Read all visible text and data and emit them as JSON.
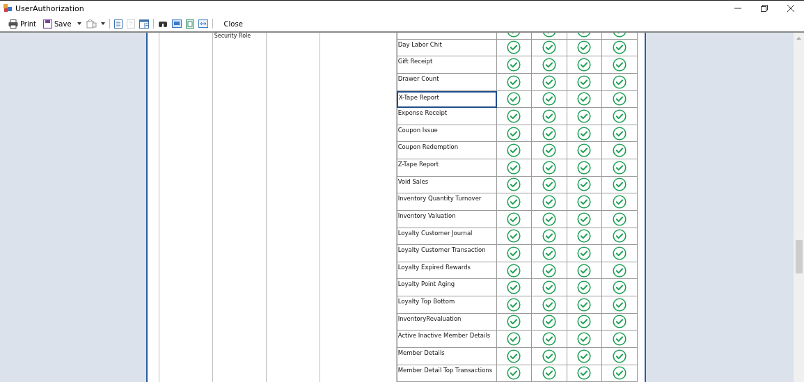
{
  "window": {
    "title": "UserAuthorization"
  },
  "toolbar": {
    "print": "Print",
    "save": "Save",
    "close": "Close"
  },
  "report": {
    "column_3_heading": "Security Role",
    "rows": [
      {
        "checks": [
          true,
          true,
          true,
          true
        ],
        "selected": false
      },
      {
        "label": "Day Labor Chit",
        "checks": [
          true,
          true,
          true,
          true
        ],
        "selected": false
      },
      {
        "label": "Gift Receipt",
        "checks": [
          true,
          true,
          true,
          true
        ],
        "selected": false
      },
      {
        "label": "Drawer Count",
        "checks": [
          true,
          true,
          true,
          true
        ],
        "selected": false
      },
      {
        "label": "X-Tape Report",
        "checks": [
          true,
          true,
          true,
          true
        ],
        "selected": true
      },
      {
        "label": "Expense Receipt",
        "checks": [
          true,
          true,
          true,
          true
        ],
        "selected": false
      },
      {
        "label": "Coupon Issue",
        "checks": [
          true,
          true,
          true,
          true
        ],
        "selected": false
      },
      {
        "label": "Coupon Redemption",
        "checks": [
          true,
          true,
          true,
          true
        ],
        "selected": false
      },
      {
        "label": "Z-Tape Report",
        "checks": [
          true,
          true,
          true,
          true
        ],
        "selected": false
      },
      {
        "label": "Void Sales",
        "checks": [
          true,
          true,
          true,
          true
        ],
        "selected": false
      },
      {
        "label": "Inventory Quantity Turnover",
        "checks": [
          true,
          true,
          true,
          true
        ],
        "selected": false
      },
      {
        "label": "Inventory Valuation",
        "checks": [
          true,
          true,
          true,
          true
        ],
        "selected": false
      },
      {
        "label": "Loyalty Customer Journal",
        "checks": [
          true,
          true,
          true,
          true
        ],
        "selected": false
      },
      {
        "label": "Loyalty Customer Transaction",
        "checks": [
          true,
          true,
          true,
          true
        ],
        "selected": false
      },
      {
        "label": "Loyalty Expired Rewards",
        "checks": [
          true,
          true,
          true,
          true
        ],
        "selected": false
      },
      {
        "label": "Loyalty Point Aging",
        "checks": [
          true,
          true,
          true,
          true
        ],
        "selected": false
      },
      {
        "label": "Loyalty Top Bottom",
        "checks": [
          true,
          true,
          true,
          true
        ],
        "selected": false
      },
      {
        "label": "InventoryRevaluation",
        "checks": [
          true,
          true,
          true,
          true
        ],
        "selected": false
      },
      {
        "label": "Active Inactive Member Details",
        "checks": [
          true,
          true,
          true,
          true
        ],
        "selected": false
      },
      {
        "label": "Member Details",
        "checks": [
          true,
          true,
          true,
          true
        ],
        "selected": false
      },
      {
        "label": "Member Detail Top Transactions",
        "checks": [
          true,
          true,
          true,
          true
        ],
        "selected": false
      }
    ]
  }
}
